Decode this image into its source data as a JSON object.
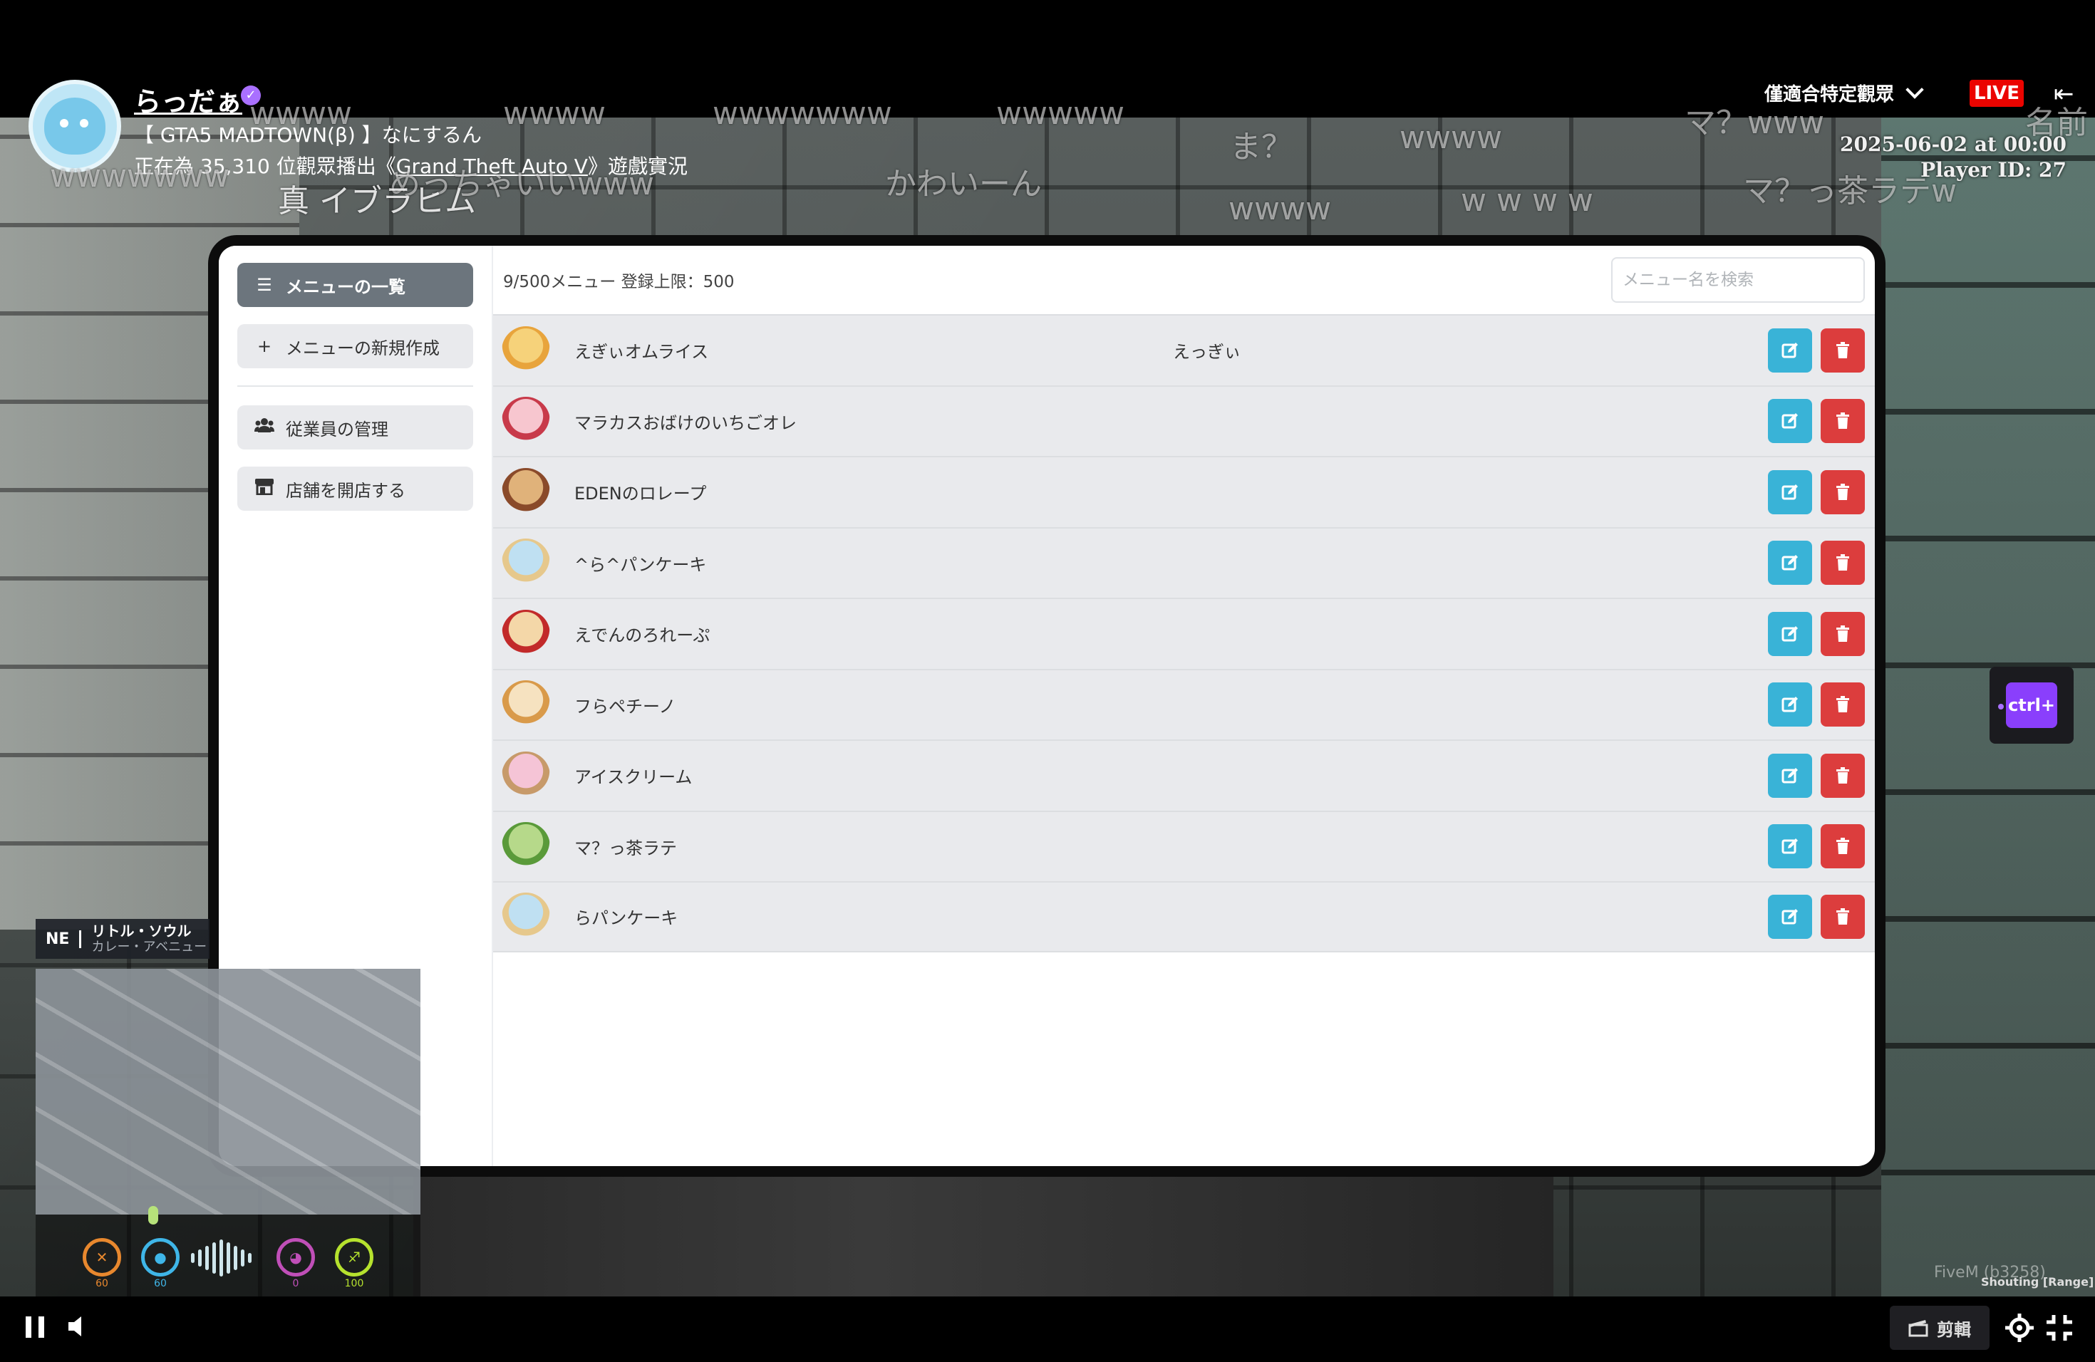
{
  "stream": {
    "streamer_name": "らっだぁ",
    "title": "【 GTA5 MADTOWN(β) 】なにするん",
    "viewers_prefix": "正在為 35,310 位觀眾播出《",
    "game_link": "Grand Theft Auto V",
    "viewers_suffix": "》遊戲實況",
    "audience_label": "僅適合特定觀眾",
    "live_badge": "LIVE"
  },
  "danmaku": [
    "wwww",
    "wwww",
    "wwwwwww",
    "wwwww",
    "ま？",
    "wwww",
    "マ？www",
    "名前",
    "wwwwwww",
    "めっちゃいいwww",
    "真 イブラヒム",
    "かわいーん",
    "wwww",
    "w w w w",
    "マ？っ茶ラテw"
  ],
  "overlay": {
    "timestamp": "2025-06-02 at 00:00",
    "player_id": "Player ID: 27"
  },
  "tablet": {
    "sidebar": {
      "menu_list": "メニューの一覧",
      "new_menu": "メニューの新規作成",
      "staff": "従業員の管理",
      "open_store": "店舗を開店する"
    },
    "count_text": "9/500メニュー  登録上限：500",
    "search_placeholder": "メニュー名を検索",
    "items": [
      {
        "name": "えぎぃオムライス",
        "desc": "えっぎぃ",
        "icon": "omurice-icon"
      },
      {
        "name": "マラカスおばけのいちごオレ",
        "desc": "",
        "icon": "strawberry-drink-icon"
      },
      {
        "name": "EDENのロレープ",
        "desc": "",
        "icon": "crepe-icon"
      },
      {
        "name": "^ら^パンケーキ",
        "desc": "",
        "icon": "pancake-icon"
      },
      {
        "name": "えでんのろれーぷ",
        "desc": "",
        "icon": "crepe-box-icon"
      },
      {
        "name": "フらペチーノ",
        "desc": "",
        "icon": "frappuccino-icon"
      },
      {
        "name": "アイスクリーム",
        "desc": "",
        "icon": "ice-cream-icon"
      },
      {
        "name": "マ？っ茶ラテ",
        "desc": "",
        "icon": "matcha-latte-icon"
      },
      {
        "name": "らパンケーキ",
        "desc": "",
        "icon": "pancake-icon"
      }
    ]
  },
  "hud": {
    "direction": "NE",
    "street": "リトル・ソウル",
    "area": "カレー・アベニュー",
    "stats": [
      {
        "value": "60",
        "color": "#e8882e",
        "icon": "hunger-icon"
      },
      {
        "value": "60",
        "color": "#3fb6e8",
        "icon": "thirst-icon"
      },
      {
        "value": "0",
        "color": "#c04fb8",
        "icon": "stress-icon"
      },
      {
        "value": "100",
        "color": "#b6e22e",
        "icon": "stamina-icon"
      }
    ]
  },
  "ctrl_widget": "ctrl+",
  "fivem_text": "FiveM (b3258)",
  "voice_mode": "Shouting [Range]",
  "player": {
    "clip_label": "剪輯"
  }
}
